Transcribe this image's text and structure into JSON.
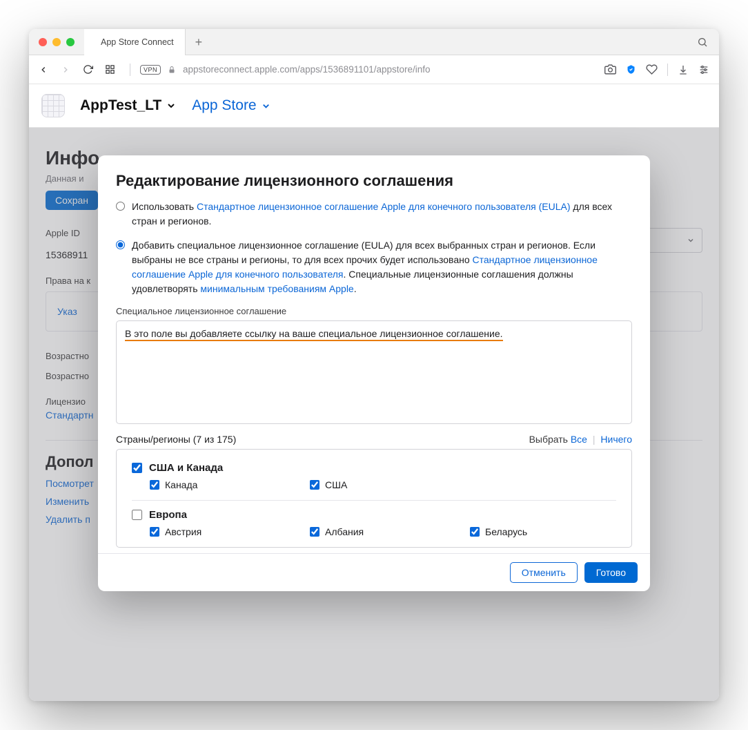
{
  "browser": {
    "tab_title": "App Store Connect",
    "url": "appstoreconnect.apple.com/apps/1536891101/appstore/info",
    "vpn_badge": "VPN"
  },
  "header": {
    "app_name": "AppTest_LT",
    "section": "App Store"
  },
  "page": {
    "title_truncated": "Инфо",
    "subtitle_truncated": "Данная и",
    "save_button": "Сохран",
    "apple_id_label": "Apple ID",
    "apple_id_value": "15368911",
    "rights_label": "Права на к",
    "set_rights_link": "Указ",
    "age_label_1": "Возрастно",
    "age_label_2": "Возрастно",
    "license_label": "Лицензио",
    "standard_link": "Стандартн",
    "additional_heading": "Допол",
    "additional_links": {
      "view": "Посмотрет",
      "edit": "Изменить",
      "delete": "Удалить п"
    }
  },
  "modal": {
    "title": "Редактирование лицензионного соглашения",
    "radio1_prefix": "Использовать ",
    "radio1_link": "Стандартное лицензионное соглашение Apple для конечного пользователя (EULA)",
    "radio1_suffix": " для всех стран и регионов.",
    "radio2_prefix": "Добавить специальное лицензионное соглашение (EULA) для всех выбранных стран и регионов. Если выбраны не все страны и регионы, то для всех прочих будет использовано ",
    "radio2_link": "Стандартное лицензионное соглашение Apple для конечного пользователя",
    "radio2_mid": ". Специальные лицензионные соглашения должны удовлетворять ",
    "radio2_link2": "минимальным требованиям Apple",
    "radio2_end": ".",
    "eula_field_label": "Специальное лицензионное соглашение",
    "eula_text": "В это поле вы добавляете ссылку на ваше специальное лицензионное соглашение.",
    "regions_label": "Страны/регионы (7 из 175)",
    "select_label": "Выбрать",
    "select_all": "Все",
    "select_none": "Ничего",
    "groups": [
      {
        "name": "США и Канада",
        "checked": true,
        "countries": [
          {
            "name": "Канада",
            "checked": true
          },
          {
            "name": "США",
            "checked": true
          }
        ]
      },
      {
        "name": "Европа",
        "checked": false,
        "countries": [
          {
            "name": "Австрия",
            "checked": true
          },
          {
            "name": "Албания",
            "checked": true
          },
          {
            "name": "Беларусь",
            "checked": true
          }
        ]
      }
    ],
    "cancel": "Отменить",
    "done": "Готово"
  }
}
